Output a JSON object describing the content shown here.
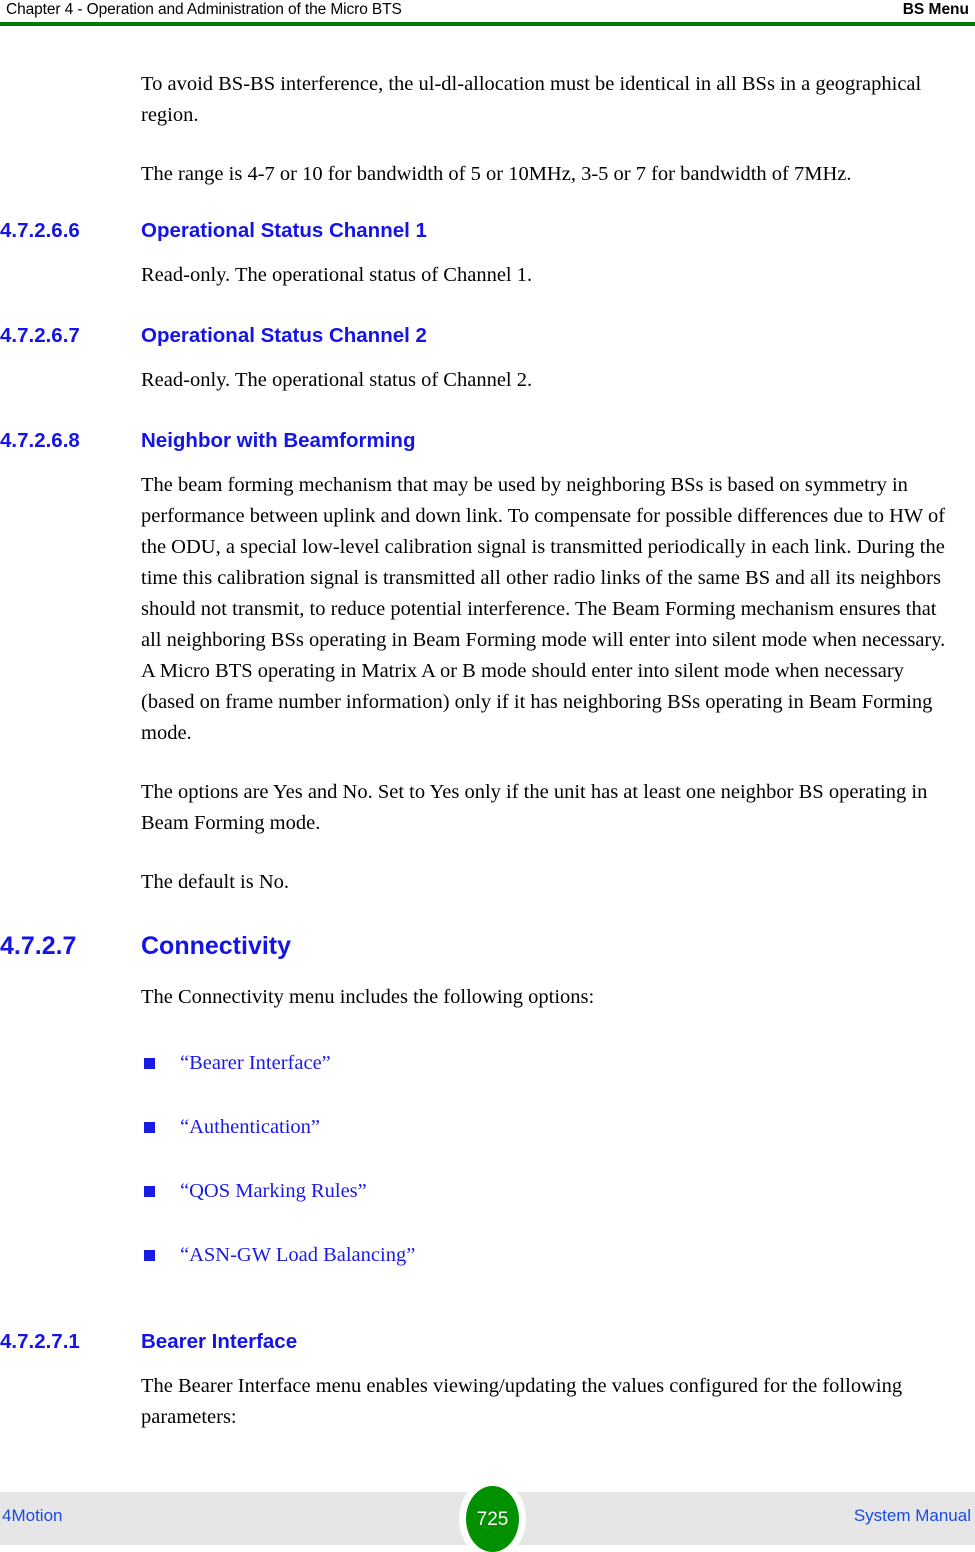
{
  "header": {
    "left": "Chapter 4 - Operation and Administration of the Micro BTS",
    "right": "BS Menu",
    "rule_color": "#008000"
  },
  "body": {
    "intro_paragraphs": [
      "To avoid BS-BS interference, the ul-dl-allocation must be identical in all BSs in a geographical region.",
      "The range is 4-7 or 10 for bandwidth of 5 or 10MHz, 3-5 or 7 for bandwidth of 7MHz."
    ],
    "sections": [
      {
        "number": "4.7.2.6.6",
        "title": "Operational Status Channel 1",
        "level": 4,
        "paragraphs": [
          "Read-only. The operational status of Channel 1."
        ]
      },
      {
        "number": "4.7.2.6.7",
        "title": "Operational Status Channel 2",
        "level": 4,
        "paragraphs": [
          "Read-only. The operational status of Channel 2."
        ]
      },
      {
        "number": "4.7.2.6.8",
        "title": "Neighbor with Beamforming",
        "level": 4,
        "paragraphs": [
          "The beam forming mechanism that may be used by neighboring BSs is based on symmetry in performance between uplink and down link. To compensate for possible differences due to HW of the ODU, a special low-level calibration signal is transmitted periodically in each link. During the time this calibration signal is transmitted all other radio links of the same BS and all its neighbors should not transmit, to reduce potential interference. The Beam Forming mechanism ensures that all neighboring BSs operating in Beam Forming mode will enter into silent mode when necessary. A Micro BTS operating in Matrix A or B mode should enter into silent mode when necessary (based on frame number information) only if it has neighboring BSs operating in Beam Forming mode.",
          "The options are Yes and No. Set to Yes only if the unit has at least one neighbor BS operating in Beam Forming mode.",
          "The default is No."
        ]
      },
      {
        "number": "4.7.2.7",
        "title": "Connectivity",
        "level": 3,
        "paragraphs": [
          "The Connectivity menu includes the following options:"
        ]
      },
      {
        "number": "4.7.2.7.1",
        "title": "Bearer Interface",
        "level": 4,
        "paragraphs": [
          "The Bearer Interface menu enables viewing/updating the values configured for the following parameters:"
        ]
      }
    ],
    "connectivity_links": [
      "“Bearer Interface”",
      "“Authentication”",
      "“QOS Marking Rules”",
      "“ASN-GW Load Balancing”"
    ],
    "heading_color": "#1414e6",
    "link_color": "#1a1ae6"
  },
  "footer": {
    "left": "4Motion",
    "page_number": "725",
    "right": "System Manual",
    "band_color": "#e6e6e6",
    "badge_color": "#009000",
    "text_color": "#1a4ae6"
  }
}
